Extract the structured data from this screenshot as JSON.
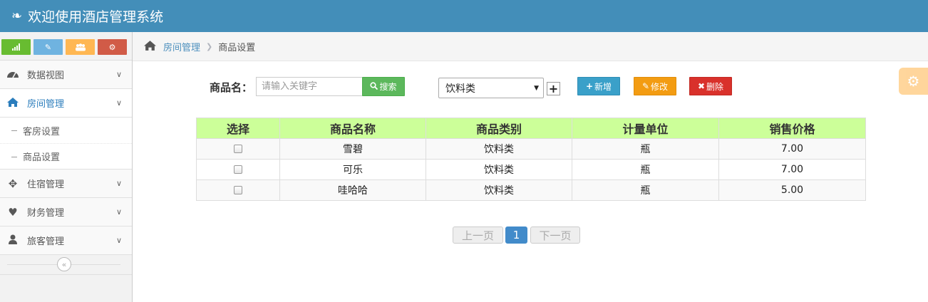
{
  "app": {
    "title": "欢迎使用酒店管理系统"
  },
  "shortcuts": [
    "signal-icon",
    "pencil-icon",
    "users-icon",
    "cogs-icon"
  ],
  "sidebar": {
    "items": [
      {
        "label": "数据视图",
        "icon": "dashboard-icon"
      },
      {
        "label": "房间管理",
        "icon": "home-icon",
        "active": true,
        "sub": [
          {
            "label": "客房设置"
          },
          {
            "label": "商品设置"
          }
        ]
      },
      {
        "label": "住宿管理",
        "icon": "move-icon"
      },
      {
        "label": "财务管理",
        "icon": "heart-icon"
      },
      {
        "label": "旅客管理",
        "icon": "user-icon"
      }
    ]
  },
  "breadcrumb": {
    "parent": "房间管理",
    "current": "商品设置"
  },
  "toolbar": {
    "name_label": "商品名：",
    "search_placeholder": "请输入关键字",
    "search_button": "搜索",
    "category_selected": "饮料类",
    "add_label": "新增",
    "edit_label": "修改",
    "delete_label": "删除"
  },
  "table": {
    "headers": [
      "选择",
      "商品名称",
      "商品类别",
      "计量单位",
      "销售价格"
    ],
    "rows": [
      {
        "name": "雪碧",
        "category": "饮料类",
        "unit": "瓶",
        "price": "7.00"
      },
      {
        "name": "可乐",
        "category": "饮料类",
        "unit": "瓶",
        "price": "7.00"
      },
      {
        "name": "哇哈哈",
        "category": "饮料类",
        "unit": "瓶",
        "price": "5.00"
      }
    ]
  },
  "pagination": {
    "prev": "上一页",
    "current": "1",
    "next": "下一页"
  },
  "colors": {
    "navbar": "#438eb9",
    "table_header": "#ccff99",
    "search": "#5cb85c",
    "add": "#3aa0c9",
    "edit": "#f39c12",
    "delete": "#d9312b"
  }
}
